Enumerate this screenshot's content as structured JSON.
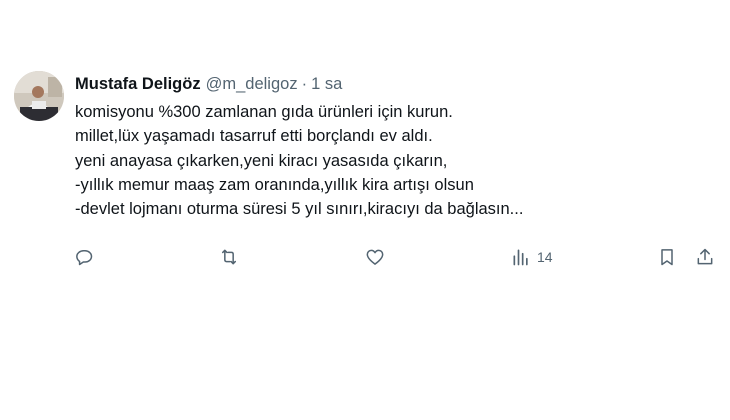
{
  "tweet": {
    "author": {
      "display_name": "Mustafa Deligöz",
      "handle": "@m_deligoz",
      "separator": "·",
      "time": "1 sa"
    },
    "text_lines": [
      "komisyonu %300 zamlanan gıda ürünleri için kurun.",
      "millet,lüx yaşamadı tasarruf etti borçlandı ev aldı.",
      "yeni anayasa çıkarken,yeni kiracı yasasıda çıkarın,",
      "-yıllık memur maaş zam oranında,yıllık kira artışı olsun",
      "-devlet lojmanı oturma süresi 5 yıl sınırı,kiracıyı da bağlasın..."
    ],
    "actions": {
      "reply_icon": "reply-icon",
      "retweet_icon": "retweet-icon",
      "like_icon": "heart-icon",
      "views_icon": "views-icon",
      "views_count": "14",
      "bookmark_icon": "bookmark-icon",
      "share_icon": "share-icon"
    }
  },
  "colors": {
    "text": "#0f1419",
    "secondary": "#536471",
    "background": "#ffffff"
  }
}
